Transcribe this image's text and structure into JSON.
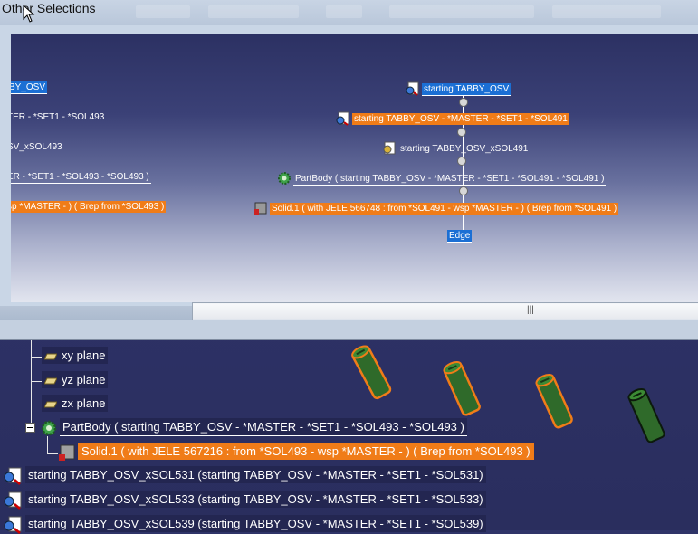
{
  "dialog": {
    "title": "Other Selections"
  },
  "graph": {
    "left_nodes": [
      {
        "label": "BY_OSV",
        "style": "blue"
      },
      {
        "label": "TER - *SET1 - *SOL493",
        "style": "plain"
      },
      {
        "label": "SV_xSOL493",
        "style": "plain"
      },
      {
        "label": "ER - *SET1 - *SOL493 - *SOL493 )",
        "style": "plain-u"
      },
      {
        "label": "sp *MASTER -  ) ( Brep from *SOL493 )",
        "style": "orange"
      }
    ],
    "right_nodes": [
      {
        "label": "starting TABBY_OSV",
        "style": "blue",
        "icon": "part-icon"
      },
      {
        "label": "starting TABBY_OSV - *MASTER - *SET1 - *SOL491",
        "style": "orange",
        "icon": "part-icon"
      },
      {
        "label": "starting TABBY_OSV_xSOL491",
        "style": "plain",
        "icon": "gear-part-icon"
      },
      {
        "label": "PartBody ( starting TABBY_OSV - *MASTER - *SET1 - *SOL491 - *SOL491 )",
        "style": "plain-u",
        "icon": "gear-body-icon"
      },
      {
        "label": "Solid.1 (  with JELE 566748 : from *SOL491 - wsp *MASTER -  ) ( Brep from *SOL491 )",
        "style": "orange",
        "icon": "solid-icon"
      },
      {
        "label": "Edge",
        "style": "blue",
        "icon": ""
      }
    ]
  },
  "scrollbar": {
    "grip": "|||"
  },
  "tree": {
    "planes": [
      {
        "label": "xy plane"
      },
      {
        "label": "yz plane"
      },
      {
        "label": "zx plane"
      }
    ],
    "partbody": "PartBody ( starting TABBY_OSV - *MASTER - *SET1 - *SOL493 - *SOL493 )",
    "solid": "Solid.1 (  with JELE 567216 : from *SOL493 - wsp *MASTER -  ) ( Brep from *SOL493 )",
    "parts": [
      {
        "label": "starting TABBY_OSV_xSOL531 (starting TABBY_OSV - *MASTER - *SET1 - *SOL531)"
      },
      {
        "label": "starting TABBY_OSV_xSOL533 (starting TABBY_OSV - *MASTER - *SET1 - *SOL533)"
      },
      {
        "label": "starting TABBY_OSV_xSOL539 (starting TABBY_OSV - *MASTER - *SET1 - *SOL539)"
      }
    ]
  },
  "colors": {
    "highlight_orange": "#f07c18",
    "selection_blue": "#1b6fd4",
    "viewport_dark": "#2f3468",
    "cylinder_green": "#2f6a2a"
  }
}
